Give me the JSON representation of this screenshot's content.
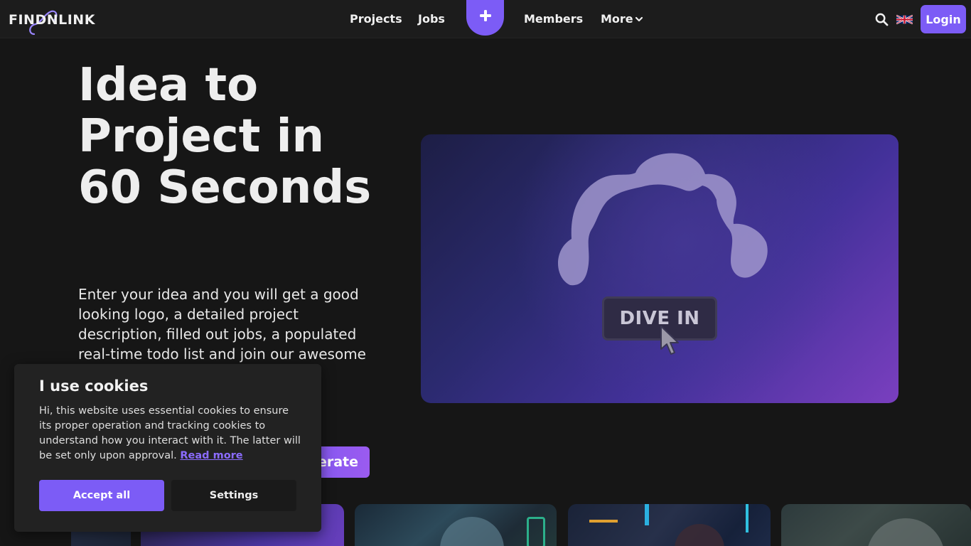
{
  "header": {
    "logo_text": "FINDNLINK",
    "nav": {
      "projects": "Projects",
      "jobs": "Jobs",
      "members": "Members",
      "more": "More"
    },
    "login_label": "Login",
    "icons": {
      "create": "plus-icon",
      "more": "chevron-down-icon",
      "search": "search-icon",
      "language": "uk-flag-icon"
    }
  },
  "hero": {
    "title": "Idea to Project in 60 Seconds",
    "description": "Enter your idea and you will get a good looking logo, a detailed project description, filled out jobs, a populated real-time todo list and join our awesome",
    "generate_label": "Generate",
    "card": {
      "button_label": "DIVE IN"
    }
  },
  "cookie": {
    "title": "I use cookies",
    "text": "Hi, this website uses essential cookies to ensure its proper operation and tracking cookies to understand how you interact with it. The latter will be set only upon approval.",
    "read_more": "Read more",
    "accept_label": "Accept all",
    "settings_label": "Settings"
  },
  "colors": {
    "accent": "#7c5cf6",
    "background": "#161616",
    "nav_background": "#1c1c1c",
    "cookie_background": "#222222"
  }
}
